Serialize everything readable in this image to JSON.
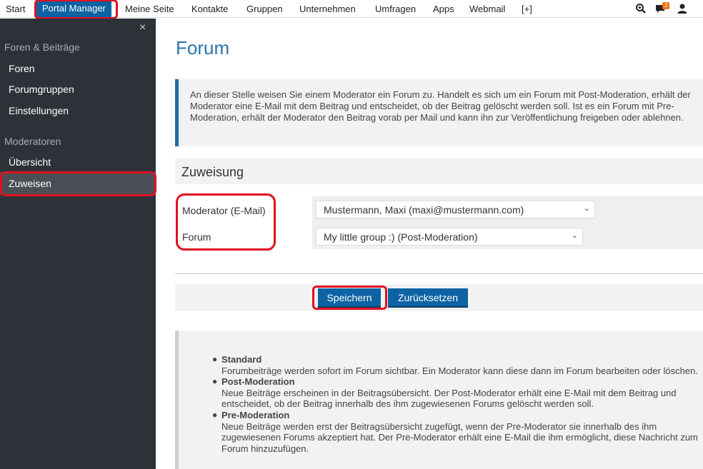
{
  "topnav": {
    "items": [
      "Start",
      "Portal Manager",
      "Meine Seite",
      "Kontakte",
      "Gruppen",
      "Unternehmen",
      "Umfragen",
      "Apps",
      "Webmail",
      "[+]"
    ],
    "notification_count": "2"
  },
  "sidebar": {
    "close": "×",
    "groups": [
      {
        "heading": "Foren & Beiträge",
        "links": [
          "Foren",
          "Forumgruppen",
          "Einstellungen"
        ]
      },
      {
        "heading": "Moderatoren",
        "links": [
          "Übersicht",
          "Zuweisen"
        ]
      }
    ],
    "active": "Zuweisen"
  },
  "main": {
    "title": "Forum",
    "info": "An dieser Stelle weisen Sie einem Moderator ein Forum zu. Handelt es sich um ein Forum mit Post-Moderation, erhält der Moderator eine E-Mail mit dem Beitrag und entscheidet, ob der Beitrag gelöscht werden soll. Ist es ein Forum mit Pre-Moderation, erhält der Moderator den Beitrag vorab per Mail und kann ihn zur Veröffentlichung freigeben oder ablehnen.",
    "section_title": "Zuweisung",
    "fields": {
      "moderator_label": "Moderator (E-Mail)",
      "moderator_value": "Mustermann, Maxi (maxi@mustermann.com)",
      "forum_label": "Forum",
      "forum_value": "My little group :) (Post-Moderation)"
    },
    "buttons": {
      "save": "Speichern",
      "reset": "Zurücksetzen"
    },
    "legend": [
      {
        "term": "Standard",
        "text": "Forumbeiträge werden sofort im Forum sichtbar. Ein Moderator kann diese dann im Forum bearbeiten oder löschen."
      },
      {
        "term": "Post-Moderation",
        "text": "Neue Beiträge erscheinen in der Beitragsübersicht. Der Post-Moderator erhält eine E-Mail mit dem Beitrag und entscheidet, ob der Beitrag innerhalb des ihm zugewiesenen Forums gelöscht werden soll."
      },
      {
        "term": "Pre-Moderation",
        "text": "Neue Beiträge werden erst der Beitragsübersicht zugefügt, wenn der Pre-Moderator sie innerhalb des ihm zugewiesenen Forums akzeptiert hat. Der Pre-Moderator erhält eine E-Mail die ihm ermöglicht, diese Nachricht zum Forum hinzuzufügen."
      }
    ]
  },
  "colors": {
    "accent": "#0d63a3",
    "sidebar": "#2d3238",
    "highlight": "#e01020",
    "badge": "#f07010"
  },
  "icons": [
    "search-icon",
    "chat-icon",
    "user-icon",
    "close-icon",
    "chevron-down-icon"
  ]
}
